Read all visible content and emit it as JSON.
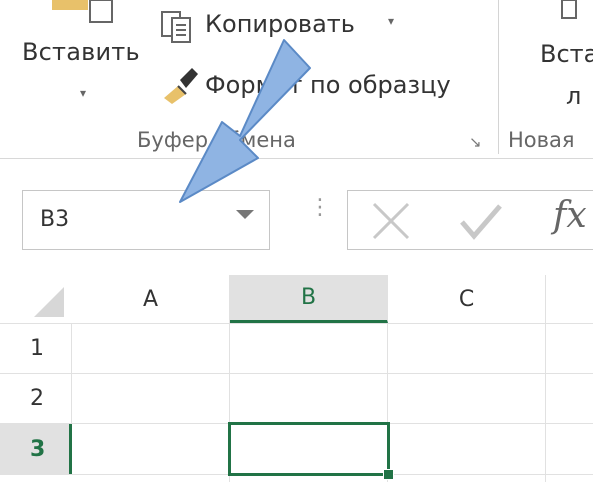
{
  "ribbon": {
    "paste_label": "Вставить",
    "paste_dropdown": "▾",
    "copy_label": "Копировать",
    "copy_dropdown": "▾",
    "format_painter_label": "Формат по образцу",
    "clipboard_group_label": "Буфер обмена",
    "new_group_partial_label": "Новая",
    "insert_partial_label_line1": "Вста",
    "insert_partial_label_line2": "л",
    "dialog_launcher": "↘"
  },
  "formula_bar": {
    "name_box_value": "B3",
    "cancel_icon": "close-icon",
    "enter_icon": "check-icon",
    "fx_label": "fx"
  },
  "sheet": {
    "columns": [
      "A",
      "B",
      "C"
    ],
    "rows": [
      "1",
      "2",
      "3"
    ],
    "selected_column": "B",
    "selected_row": "3",
    "accent_color": "#217346"
  },
  "annotation": {
    "arrow_color": "#8fb4e3"
  }
}
